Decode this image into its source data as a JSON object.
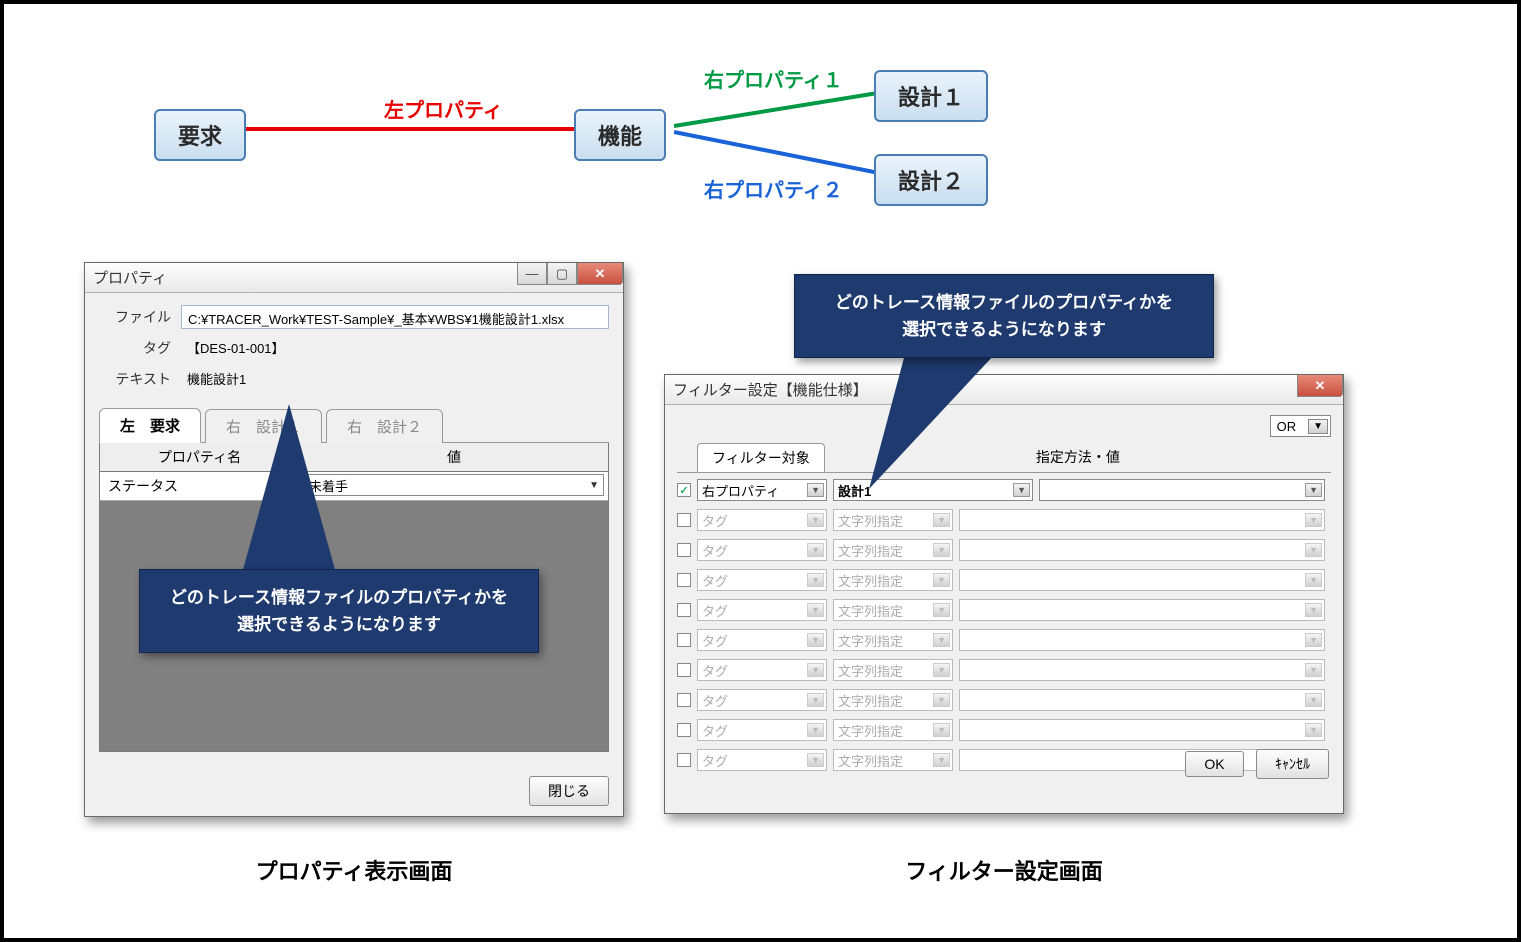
{
  "diagram": {
    "nodes": {
      "req": "要求",
      "func": "機能",
      "des1": "設計１",
      "des2": "設計２"
    },
    "labels": {
      "left": "左プロパティ",
      "right1": "右プロパティ１",
      "right2": "右プロパティ２"
    }
  },
  "propDialog": {
    "title": "プロパティ",
    "fileLabel": "ファイル",
    "fileValue": "C:¥TRACER_Work¥TEST-Sample¥_基本¥WBS¥1機能設計1.xlsx",
    "tagLabel": "タグ",
    "tagValue": "【DES-01-001】",
    "textLabel": "テキスト",
    "textValue": "機能設計1",
    "tabs": [
      {
        "side": "左",
        "name": "要求",
        "active": true
      },
      {
        "side": "右",
        "name": "設計１",
        "active": false
      },
      {
        "side": "右",
        "name": "設計２",
        "active": false
      }
    ],
    "gridHeaders": {
      "name": "プロパティ名",
      "value": "値"
    },
    "rows": [
      {
        "name": "ステータス",
        "value": "未着手"
      }
    ],
    "closeBtn": "閉じる"
  },
  "filterDialog": {
    "title": "フィルター設定【機能仕様】",
    "logic": "OR",
    "headers": {
      "target": "フィルター対象",
      "method": "指定方法・値"
    },
    "rows": [
      {
        "checked": true,
        "target": "右プロパティ",
        "method": "設計1",
        "value": "",
        "active": true
      },
      {
        "checked": false,
        "target": "タグ",
        "method": "文字列指定",
        "value": "",
        "active": false
      },
      {
        "checked": false,
        "target": "タグ",
        "method": "文字列指定",
        "value": "",
        "active": false
      },
      {
        "checked": false,
        "target": "タグ",
        "method": "文字列指定",
        "value": "",
        "active": false
      },
      {
        "checked": false,
        "target": "タグ",
        "method": "文字列指定",
        "value": "",
        "active": false
      },
      {
        "checked": false,
        "target": "タグ",
        "method": "文字列指定",
        "value": "",
        "active": false
      },
      {
        "checked": false,
        "target": "タグ",
        "method": "文字列指定",
        "value": "",
        "active": false
      },
      {
        "checked": false,
        "target": "タグ",
        "method": "文字列指定",
        "value": "",
        "active": false
      },
      {
        "checked": false,
        "target": "タグ",
        "method": "文字列指定",
        "value": "",
        "active": false
      },
      {
        "checked": false,
        "target": "タグ",
        "method": "文字列指定",
        "value": "",
        "active": false
      }
    ],
    "ok": "OK",
    "cancel": "ｷｬﾝｾﾙ"
  },
  "callout": {
    "line1": "どのトレース情報ファイルのプロパティかを",
    "line2": "選択できるようになります"
  },
  "captions": {
    "left": "プロパティ表示画面",
    "right": "フィルター設定画面"
  }
}
